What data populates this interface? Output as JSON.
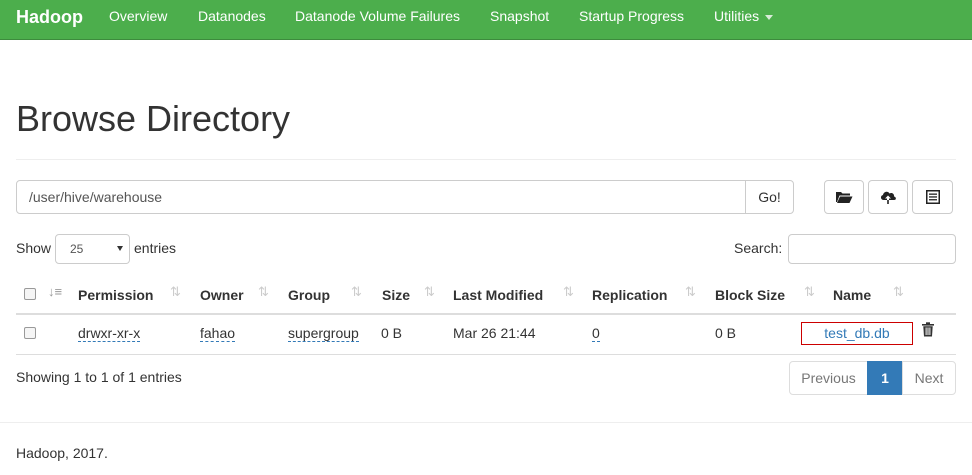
{
  "navbar": {
    "brand": "Hadoop",
    "items": [
      "Overview",
      "Datanodes",
      "Datanode Volume Failures",
      "Snapshot",
      "Startup Progress",
      "Utilities"
    ],
    "accent_color": "#4cae4c"
  },
  "page": {
    "title": "Browse Directory"
  },
  "path_bar": {
    "value": "/user/hive/warehouse",
    "go_label": "Go!",
    "icons": [
      "folder-open-icon",
      "cloud-upload-icon",
      "list-alt-icon"
    ]
  },
  "length": {
    "show_label": "Show",
    "selected": "25",
    "entries_label": "entries"
  },
  "search": {
    "label": "Search:",
    "value": ""
  },
  "table": {
    "columns": [
      "Permission",
      "Owner",
      "Group",
      "Size",
      "Last Modified",
      "Replication",
      "Block Size",
      "Name"
    ],
    "rows": [
      {
        "permission": "drwxr-xr-x",
        "owner": "fahao",
        "group": "supergroup",
        "size": "0 B",
        "last_modified": "Mar 26 21:44",
        "replication": "0",
        "block_size": "0 B",
        "name": "test_db.db"
      }
    ]
  },
  "info": "Showing 1 to 1 of 1 entries",
  "pagination": {
    "previous": "Previous",
    "current": "1",
    "next": "Next"
  },
  "footer": "Hadoop, 2017."
}
